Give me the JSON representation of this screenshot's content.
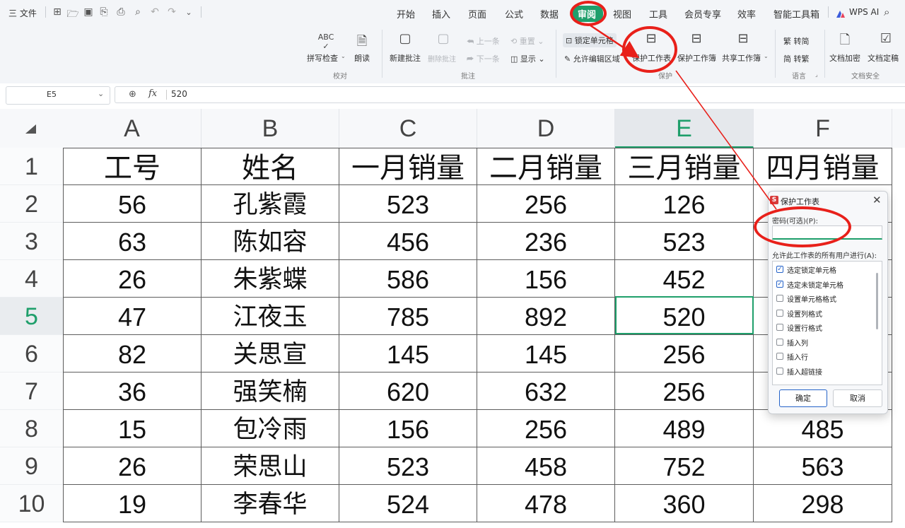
{
  "menubar": {
    "file_label": "三 文件",
    "tabs": [
      "开始",
      "插入",
      "页面",
      "公式",
      "数据",
      "审阅",
      "视图",
      "工具",
      "会员专享",
      "效率",
      "智能工具箱"
    ],
    "active_tab": "审阅",
    "ai_label": "WPS AI"
  },
  "ribbon": {
    "spell_check": "拼写检查",
    "read_aloud": "朗读",
    "group_proofing": "校对",
    "new_comment": "新建批注",
    "delete_comment": "删除批注",
    "prev_comment": "上一条",
    "next_comment": "下一条",
    "reset": "重置",
    "show": "显示",
    "group_comments": "批注",
    "lock_cell": "锁定单元格",
    "allow_edit_range": "允许编辑区域",
    "protect_sheet": "保护工作表",
    "protect_workbook": "保护工作簿",
    "share_workbook": "共享工作簿",
    "group_protect": "保护",
    "trad_to_simp": "繁 转简",
    "simp_to_trad": "简 转繁",
    "group_language": "语言",
    "doc_encrypt": "文档加密",
    "doc_finalize": "文档定稿",
    "group_doc_security": "文档安全"
  },
  "formula_bar": {
    "cell_ref": "E5",
    "fx": "fx",
    "value": "520"
  },
  "sheet": {
    "columns": [
      "A",
      "B",
      "C",
      "D",
      "E",
      "F"
    ],
    "row_numbers": [
      "1",
      "2",
      "3",
      "4",
      "5",
      "6",
      "7",
      "8",
      "9",
      "10"
    ],
    "header": [
      "工号",
      "姓名",
      "一月销量",
      "二月销量",
      "三月销量",
      "四月销量"
    ],
    "rows": [
      [
        "56",
        "孔紫霞",
        "523",
        "256",
        "126",
        ""
      ],
      [
        "63",
        "陈如容",
        "456",
        "236",
        "523",
        ""
      ],
      [
        "26",
        "朱紫蝶",
        "586",
        "156",
        "452",
        ""
      ],
      [
        "47",
        "江夜玉",
        "785",
        "892",
        "520",
        ""
      ],
      [
        "82",
        "关思宣",
        "145",
        "145",
        "256",
        ""
      ],
      [
        "36",
        "强笑楠",
        "620",
        "632",
        "256",
        ""
      ],
      [
        "15",
        "包冷雨",
        "156",
        "256",
        "489",
        "485"
      ],
      [
        "26",
        "荣思山",
        "523",
        "458",
        "752",
        "563"
      ],
      [
        "19",
        "李春华",
        "524",
        "478",
        "360",
        "298"
      ]
    ],
    "selected_cell": "E5"
  },
  "dialog": {
    "logo": "S",
    "title": "保护工作表",
    "close": "✕",
    "password_label": "密码(可选)(P):",
    "password_value": "",
    "allow_label": "允许此工作表的所有用户进行(A):",
    "options": [
      {
        "label": "选定锁定单元格",
        "checked": true
      },
      {
        "label": "选定未锁定单元格",
        "checked": true
      },
      {
        "label": "设置单元格格式",
        "checked": false
      },
      {
        "label": "设置列格式",
        "checked": false
      },
      {
        "label": "设置行格式",
        "checked": false
      },
      {
        "label": "插入列",
        "checked": false
      },
      {
        "label": "插入行",
        "checked": false
      },
      {
        "label": "插入超链接",
        "checked": false
      }
    ],
    "ok": "确定",
    "cancel": "取消"
  },
  "colors": {
    "accent": "#1f9f6b",
    "annotation": "#e8201a",
    "dialog_button_focus": "#2563c9"
  }
}
